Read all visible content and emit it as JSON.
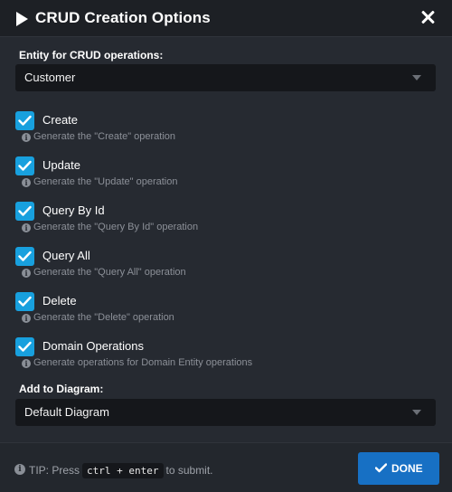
{
  "dialog": {
    "title": "CRUD Creation Options"
  },
  "entity": {
    "label": "Entity for CRUD operations:",
    "value": "Customer"
  },
  "options": [
    {
      "label": "Create",
      "hint": "Generate the \"Create\" operation",
      "checked": true
    },
    {
      "label": "Update",
      "hint": "Generate the \"Update\" operation",
      "checked": true
    },
    {
      "label": "Query By Id",
      "hint": "Generate the \"Query By Id\" operation",
      "checked": true
    },
    {
      "label": "Query All",
      "hint": "Generate the \"Query All\" operation",
      "checked": true
    },
    {
      "label": "Delete",
      "hint": "Generate the \"Delete\" operation",
      "checked": true
    },
    {
      "label": "Domain Operations",
      "hint": "Generate operations for Domain Entity operations",
      "checked": true
    }
  ],
  "diagram": {
    "label": "Add to Diagram:",
    "value": "Default Diagram"
  },
  "footer": {
    "tip_prefix": "TIP: Press",
    "shortcut": "ctrl + enter",
    "tip_suffix": "to submit.",
    "done_label": "DONE"
  },
  "colors": {
    "accent": "#18a0de",
    "primary_button": "#1770c4",
    "background": "#262a31",
    "header_background": "#1d2025"
  },
  "icons": {
    "title": "play-icon",
    "close": "close-icon",
    "hint": "info-icon",
    "done": "check-icon"
  }
}
